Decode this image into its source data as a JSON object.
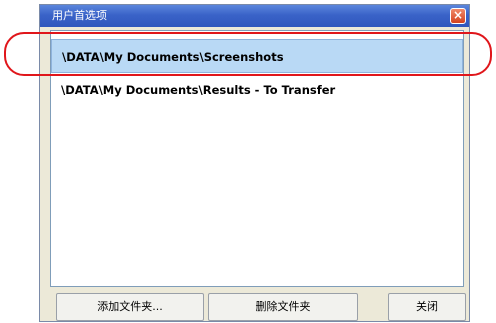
{
  "dialog": {
    "title": "用户首选项",
    "close_symbol": "×"
  },
  "folders": [
    "\\DATA\\My Documents\\Screenshots",
    "\\DATA\\My Documents\\Results - To Transfer"
  ],
  "selected_index": 0,
  "buttons": {
    "add": "添加文件夹...",
    "delete": "删除文件夹",
    "close": "关闭"
  },
  "colors": {
    "titlebar": "#3a63c8",
    "selection": "#b9d9f5",
    "annotation": "#e0161b"
  },
  "icons": {
    "close": "close-icon"
  }
}
